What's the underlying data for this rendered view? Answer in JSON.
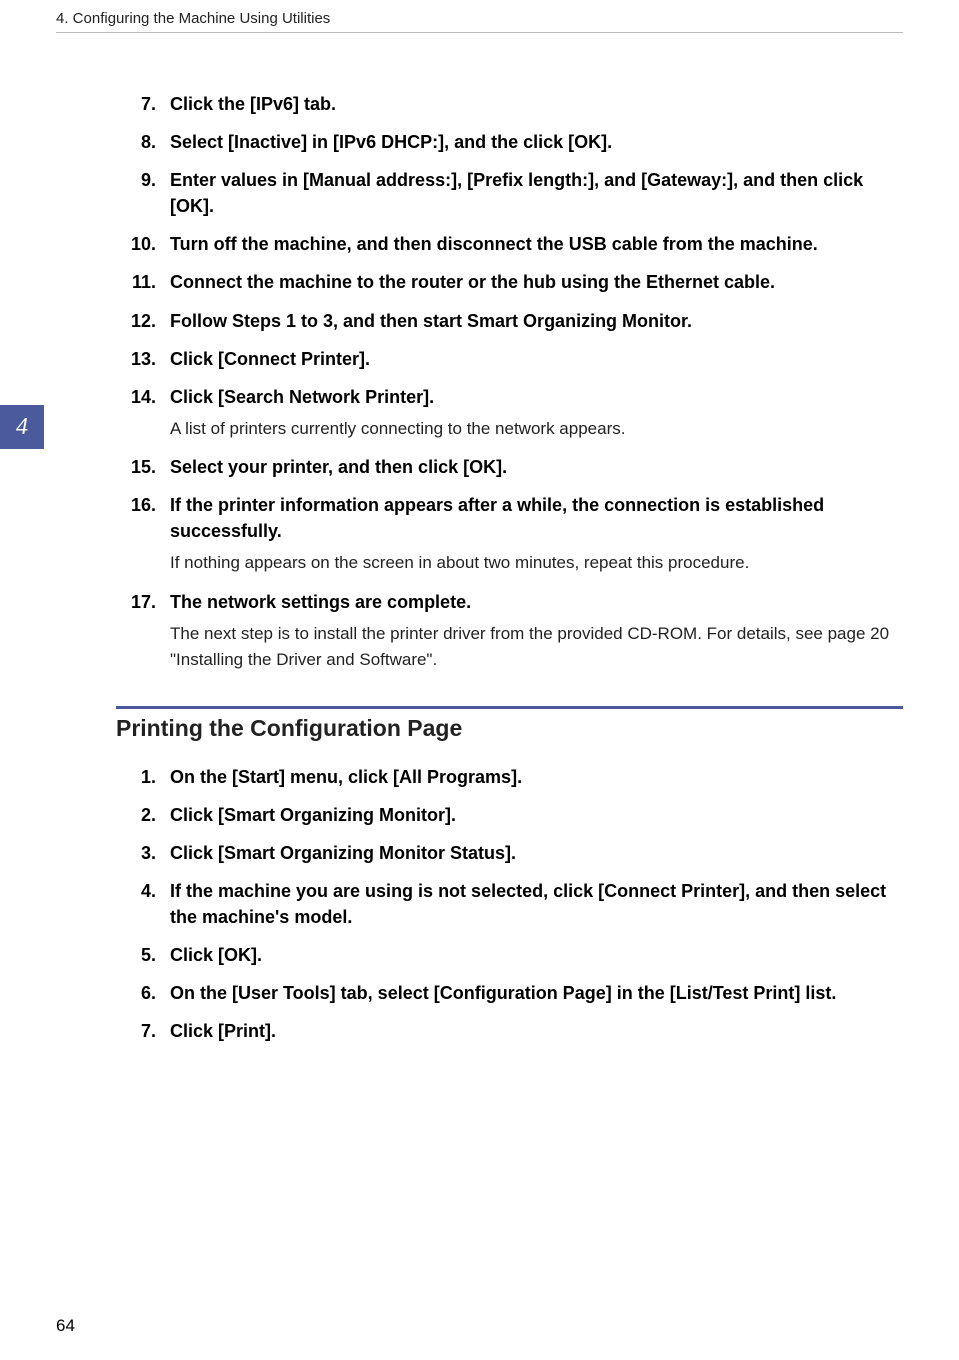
{
  "header": {
    "breadcrumb": "4. Configuring the Machine Using Utilities"
  },
  "chapter_tab": "4",
  "steps_a": [
    {
      "num": "7",
      "title": "Click the [IPv6] tab.",
      "note": ""
    },
    {
      "num": "8",
      "title": "Select [Inactive] in [IPv6 DHCP:], and the click [OK].",
      "note": ""
    },
    {
      "num": "9",
      "title": "Enter values in [Manual address:], [Prefix length:], and [Gateway:], and then click [OK].",
      "note": ""
    },
    {
      "num": "10",
      "title": "Turn off the machine, and then disconnect the USB cable from the machine.",
      "note": ""
    },
    {
      "num": "11",
      "title": "Connect the machine to the router or the hub using the Ethernet cable.",
      "note": ""
    },
    {
      "num": "12",
      "title": "Follow Steps 1 to 3, and then start Smart Organizing Monitor.",
      "note": ""
    },
    {
      "num": "13",
      "title": "Click [Connect Printer].",
      "note": ""
    },
    {
      "num": "14",
      "title": "Click [Search Network Printer].",
      "note": "A list of printers currently connecting to the network appears."
    },
    {
      "num": "15",
      "title": "Select your printer, and then click [OK].",
      "note": ""
    },
    {
      "num": "16",
      "title": "If the printer information appears after a while, the connection is established successfully.",
      "note": "If nothing appears on the screen in about two minutes, repeat this procedure."
    },
    {
      "num": "17",
      "title": "The network settings are complete.",
      "note": "The next step is to install the printer driver from the provided CD-ROM. For details, see page 20 \"Installing the Driver and Software\"."
    }
  ],
  "section_heading": "Printing the Configuration Page",
  "steps_b": [
    {
      "num": "1",
      "title": "On the [Start] menu, click [All Programs].",
      "note": ""
    },
    {
      "num": "2",
      "title": "Click [Smart Organizing Monitor].",
      "note": ""
    },
    {
      "num": "3",
      "title": "Click [Smart Organizing Monitor Status].",
      "note": ""
    },
    {
      "num": "4",
      "title": "If the machine you are using is not selected, click [Connect Printer], and then select the machine's model.",
      "note": ""
    },
    {
      "num": "5",
      "title": "Click [OK].",
      "note": ""
    },
    {
      "num": "6",
      "title": "On the [User Tools] tab, select [Configuration Page] in the [List/Test Print] list.",
      "note": ""
    },
    {
      "num": "7",
      "title": "Click [Print].",
      "note": ""
    }
  ],
  "page_number": "64"
}
